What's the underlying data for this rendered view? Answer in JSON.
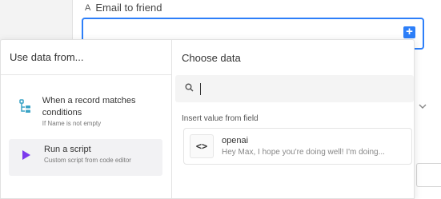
{
  "background": {
    "field_label_icon": "A",
    "field_label": "Email to friend",
    "add_button_glyph": "+"
  },
  "popover": {
    "left": {
      "header": "Use data from...",
      "items": [
        {
          "title": "When a record matches conditions",
          "subtitle": "If Name is not empty",
          "icon": "record-conditions-icon"
        },
        {
          "title": "Run a script",
          "subtitle": "Custom script from code editor",
          "icon": "play-icon",
          "selected": true
        }
      ]
    },
    "right": {
      "header": "Choose data",
      "search": {
        "value": "",
        "placeholder": ""
      },
      "section_label": "Insert value from field",
      "fields": [
        {
          "title": "openai",
          "subtitle": "Hey Max, I hope you're doing well! I'm doing...",
          "icon": "code-icon"
        }
      ]
    }
  },
  "colors": {
    "accent": "#2d7ff9",
    "script_icon": "#7c3aed"
  }
}
